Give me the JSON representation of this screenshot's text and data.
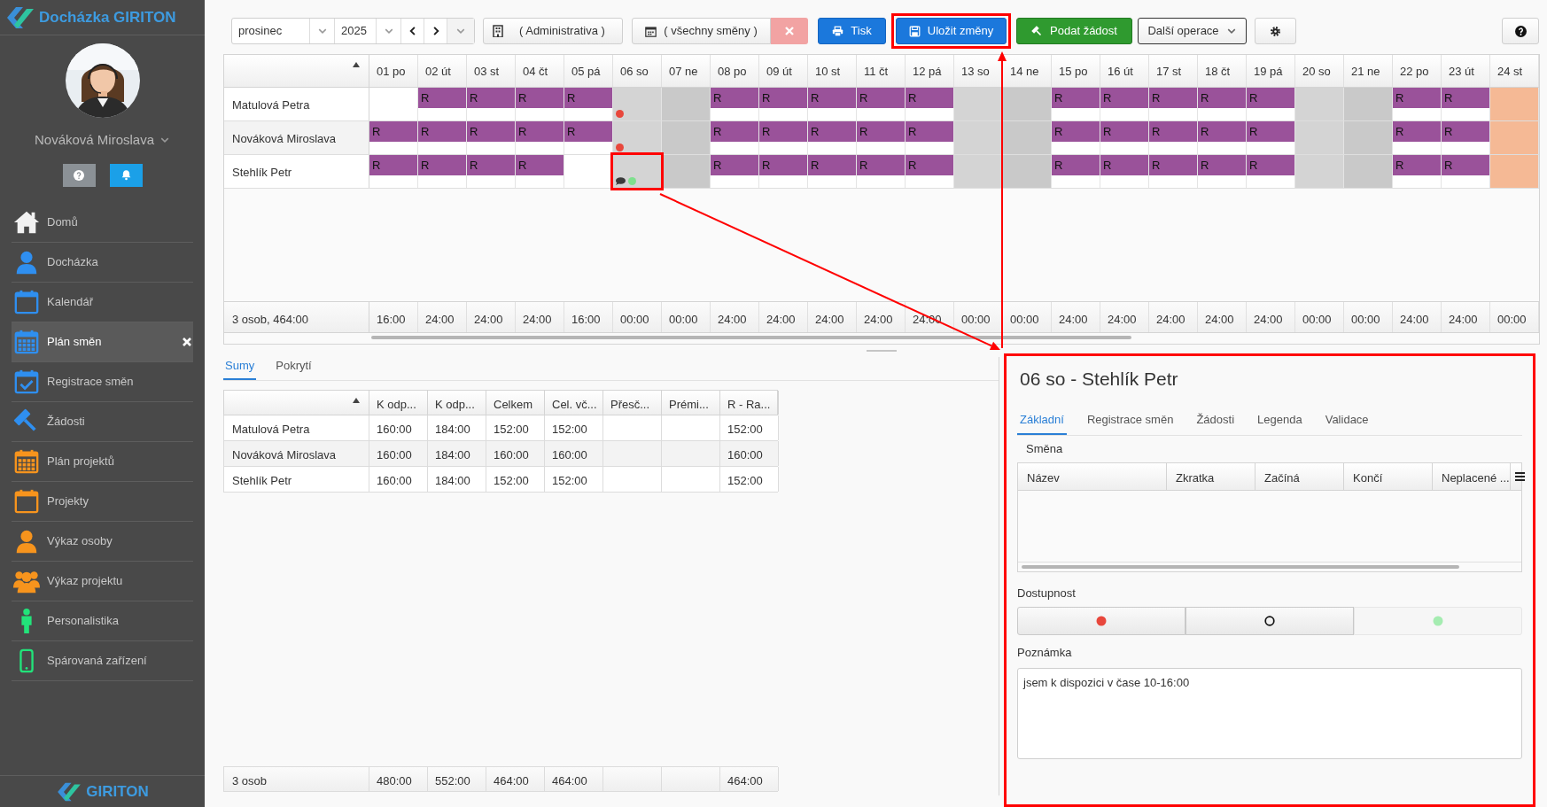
{
  "app": {
    "title": "Docházka GIRITON",
    "footer_logo": "GIRITON"
  },
  "user": {
    "name": "Nováková Miroslava"
  },
  "menu": [
    {
      "label": "Domů",
      "selected": false
    },
    {
      "label": "Docházka",
      "selected": false
    },
    {
      "label": "Kalendář",
      "selected": false
    },
    {
      "label": "Plán směn",
      "selected": true
    },
    {
      "label": "Registrace směn",
      "selected": false
    },
    {
      "label": "Žádosti",
      "selected": false
    },
    {
      "label": "Plán projektů",
      "selected": false
    },
    {
      "label": "Projekty",
      "selected": false
    },
    {
      "label": "Výkaz osoby",
      "selected": false
    },
    {
      "label": "Výkaz projektu",
      "selected": false
    },
    {
      "label": "Personalistika",
      "selected": false
    },
    {
      "label": "Spárovaná zařízení",
      "selected": false
    }
  ],
  "toolbar": {
    "month": "prosinec",
    "year": "2025",
    "department": "( Administrativa )",
    "shift_filter": "( všechny směny )",
    "buttons": [
      {
        "kind": "print",
        "label": "Tisk",
        "annotated": false
      },
      {
        "kind": "save",
        "label": "Uložit změny",
        "annotated": true
      },
      {
        "kind": "request",
        "label": "Podat žádost",
        "annotated": false
      },
      {
        "kind": "menu",
        "label": "Další operace",
        "annotated": false
      }
    ]
  },
  "plan": {
    "days": [
      "01 po",
      "02 út",
      "03 st",
      "04 čt",
      "05 pá",
      "06 so",
      "07 ne",
      "08 po",
      "09 út",
      "10 st",
      "11 čt",
      "12 pá",
      "13 so",
      "14 ne",
      "15 po",
      "16 út",
      "17 st",
      "18 čt",
      "19 pá",
      "20 so",
      "21 ne",
      "22 po",
      "23 út",
      "24 st"
    ],
    "rows": [
      {
        "name": "Matulová Petra",
        "cells": [
          {
            "kind": "empty"
          },
          {
            "kind": "shift",
            "label": "R"
          },
          {
            "kind": "shift",
            "label": "R"
          },
          {
            "kind": "shift",
            "label": "R"
          },
          {
            "kind": "shift",
            "label": "R"
          },
          {
            "kind": "weekend",
            "color": "#e8473c"
          },
          {
            "kind": "weekend"
          },
          {
            "kind": "shift",
            "label": "R"
          },
          {
            "kind": "shift",
            "label": "R"
          },
          {
            "kind": "shift",
            "label": "R"
          },
          {
            "kind": "shift",
            "label": "R"
          },
          {
            "kind": "shift",
            "label": "R"
          },
          {
            "kind": "weekend"
          },
          {
            "kind": "weekend"
          },
          {
            "kind": "shift",
            "label": "R"
          },
          {
            "kind": "shift",
            "label": "R"
          },
          {
            "kind": "shift",
            "label": "R"
          },
          {
            "kind": "shift",
            "label": "R"
          },
          {
            "kind": "shift",
            "label": "R"
          },
          {
            "kind": "weekend"
          },
          {
            "kind": "weekend"
          },
          {
            "kind": "shift",
            "label": "R"
          },
          {
            "kind": "shift",
            "label": "R"
          },
          {
            "kind": "holiday"
          }
        ]
      },
      {
        "name": "Nováková Miroslava",
        "cells": [
          {
            "kind": "shift",
            "label": "R"
          },
          {
            "kind": "shift",
            "label": "R"
          },
          {
            "kind": "shift",
            "label": "R"
          },
          {
            "kind": "shift",
            "label": "R"
          },
          {
            "kind": "shift",
            "label": "R"
          },
          {
            "kind": "weekend",
            "color": "#e8473c"
          },
          {
            "kind": "weekend"
          },
          {
            "kind": "shift",
            "label": "R"
          },
          {
            "kind": "shift",
            "label": "R"
          },
          {
            "kind": "shift",
            "label": "R"
          },
          {
            "kind": "shift",
            "label": "R"
          },
          {
            "kind": "shift",
            "label": "R"
          },
          {
            "kind": "weekend"
          },
          {
            "kind": "weekend"
          },
          {
            "kind": "shift",
            "label": "R"
          },
          {
            "kind": "shift",
            "label": "R"
          },
          {
            "kind": "shift",
            "label": "R"
          },
          {
            "kind": "shift",
            "label": "R"
          },
          {
            "kind": "shift",
            "label": "R"
          },
          {
            "kind": "weekend"
          },
          {
            "kind": "weekend"
          },
          {
            "kind": "shift",
            "label": "R"
          },
          {
            "kind": "shift",
            "label": "R"
          },
          {
            "kind": "holiday"
          }
        ]
      },
      {
        "name": "Stehlík Petr",
        "cells": [
          {
            "kind": "shift",
            "label": "R"
          },
          {
            "kind": "shift",
            "label": "R"
          },
          {
            "kind": "shift",
            "label": "R"
          },
          {
            "kind": "shift",
            "label": "R"
          },
          {
            "kind": "empty"
          },
          {
            "kind": "weekend",
            "color": "#7fe08e",
            "note": true,
            "annotated": true
          },
          {
            "kind": "weekend"
          },
          {
            "kind": "shift",
            "label": "R"
          },
          {
            "kind": "shift",
            "label": "R"
          },
          {
            "kind": "shift",
            "label": "R"
          },
          {
            "kind": "shift",
            "label": "R"
          },
          {
            "kind": "shift",
            "label": "R"
          },
          {
            "kind": "weekend"
          },
          {
            "kind": "weekend"
          },
          {
            "kind": "shift",
            "label": "R"
          },
          {
            "kind": "shift",
            "label": "R"
          },
          {
            "kind": "shift",
            "label": "R"
          },
          {
            "kind": "shift",
            "label": "R"
          },
          {
            "kind": "shift",
            "label": "R"
          },
          {
            "kind": "weekend"
          },
          {
            "kind": "weekend"
          },
          {
            "kind": "shift",
            "label": "R"
          },
          {
            "kind": "shift",
            "label": "R"
          },
          {
            "kind": "holiday"
          }
        ]
      }
    ],
    "summary": {
      "label": "3 osob, 464:00",
      "values": [
        "16:00",
        "24:00",
        "24:00",
        "24:00",
        "16:00",
        "00:00",
        "00:00",
        "24:00",
        "24:00",
        "24:00",
        "24:00",
        "24:00",
        "00:00",
        "00:00",
        "24:00",
        "24:00",
        "24:00",
        "24:00",
        "24:00",
        "00:00",
        "00:00",
        "24:00",
        "24:00",
        "00:00"
      ]
    }
  },
  "bottom_tabs": [
    {
      "label": "Sumy",
      "selected": true
    },
    {
      "label": "Pokrytí",
      "selected": false
    }
  ],
  "sums": {
    "columns": [
      "K odp...",
      "K odp...",
      "Celkem",
      "Cel. vč...",
      "Přesč...",
      "Prémi...",
      "R - Ra..."
    ],
    "rows": [
      {
        "name": "Matulová Petra",
        "values": [
          {
            "kind": "value",
            "text": "160:00"
          },
          {
            "kind": "value",
            "text": "184:00"
          },
          {
            "kind": "value",
            "text": "152:00"
          },
          {
            "kind": "value",
            "text": "152:00"
          },
          {
            "kind": "blank"
          },
          {
            "kind": "blank"
          },
          {
            "kind": "value",
            "text": "152:00"
          }
        ]
      },
      {
        "name": "Nováková Miroslava",
        "values": [
          {
            "kind": "value",
            "text": "160:00"
          },
          {
            "kind": "value",
            "text": "184:00"
          },
          {
            "kind": "value",
            "text": "160:00"
          },
          {
            "kind": "value",
            "text": "160:00"
          },
          {
            "kind": "blank"
          },
          {
            "kind": "blank"
          },
          {
            "kind": "value",
            "text": "160:00"
          }
        ]
      },
      {
        "name": "Stehlík Petr",
        "values": [
          {
            "kind": "value",
            "text": "160:00"
          },
          {
            "kind": "value",
            "text": "184:00"
          },
          {
            "kind": "value",
            "text": "152:00"
          },
          {
            "kind": "value",
            "text": "152:00"
          },
          {
            "kind": "blank"
          },
          {
            "kind": "blank"
          },
          {
            "kind": "value",
            "text": "152:00"
          }
        ]
      }
    ],
    "footer": {
      "label": "3 osob",
      "values": [
        {
          "kind": "value",
          "text": "480:00"
        },
        {
          "kind": "value",
          "text": "552:00"
        },
        {
          "kind": "value",
          "text": "464:00"
        },
        {
          "kind": "value",
          "text": "464:00"
        },
        {
          "kind": "blank"
        },
        {
          "kind": "blank"
        },
        {
          "kind": "value",
          "text": "464:00"
        }
      ]
    }
  },
  "detail": {
    "title": "06 so - Stehlík Petr",
    "annotated": true,
    "tabs": [
      {
        "label": "Základní",
        "selected": true
      },
      {
        "label": "Registrace směn",
        "selected": false
      },
      {
        "label": "Žádosti",
        "selected": false
      },
      {
        "label": "Legenda",
        "selected": false
      },
      {
        "label": "Validace",
        "selected": false
      }
    ],
    "shift_section": "Směna",
    "shift_columns": [
      "Název",
      "Zkratka",
      "Začíná",
      "Končí",
      "Neplacené ..."
    ],
    "availability_label": "Dostupnost",
    "availability_options": [
      {
        "kind": "unavailable",
        "selected": false
      },
      {
        "kind": "unknown",
        "selected": false
      },
      {
        "kind": "available",
        "selected": true
      }
    ],
    "note_label": "Poznámka",
    "note": "jsem k dispozici v čase 10-16:00"
  }
}
